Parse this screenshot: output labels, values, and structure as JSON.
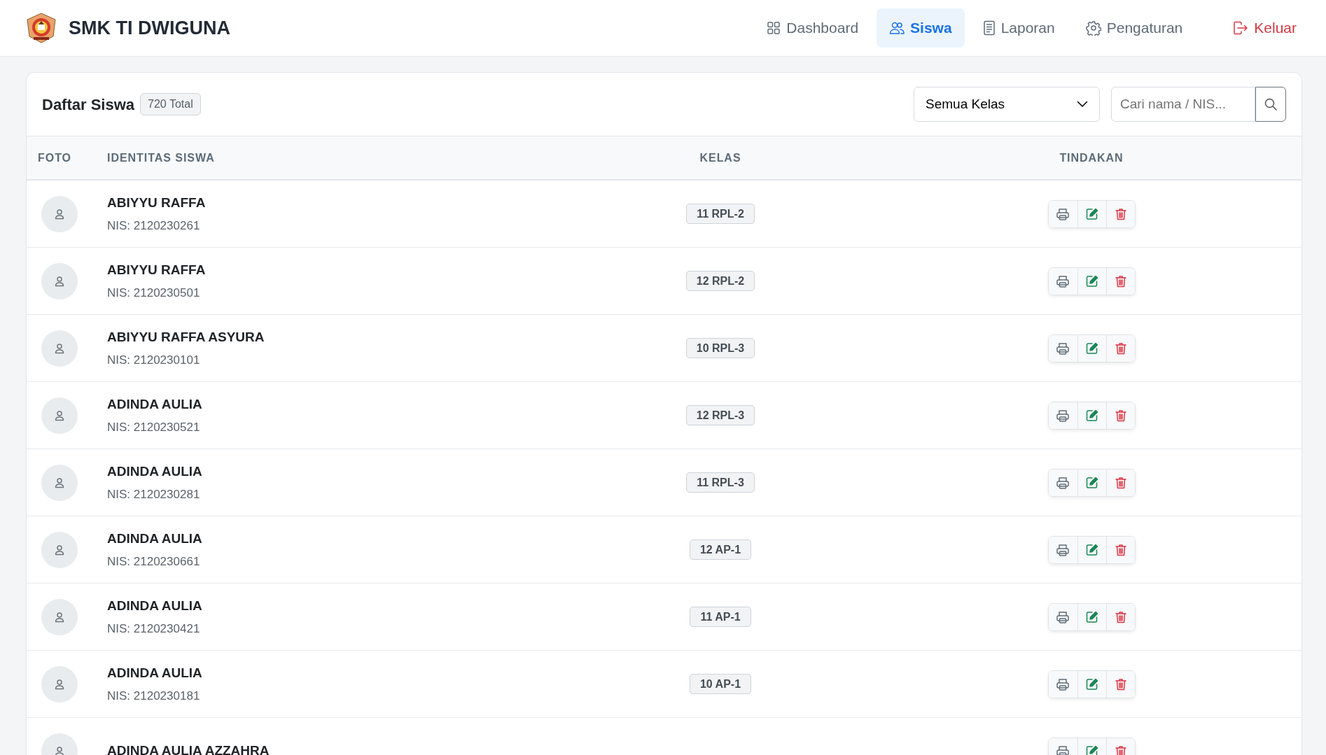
{
  "brand": {
    "name": "SMK TI DWIGUNA"
  },
  "nav": [
    {
      "kind": "grid",
      "label": "Dashboard",
      "selected": false
    },
    {
      "kind": "people",
      "label": "Siswa",
      "selected": true
    },
    {
      "kind": "doc",
      "label": "Laporan",
      "selected": false
    },
    {
      "kind": "gear",
      "label": "Pengaturan",
      "selected": false
    }
  ],
  "logout": {
    "label": "Keluar"
  },
  "card": {
    "title": "Daftar Siswa",
    "count": "720 Total",
    "filter": "Semua Kelas",
    "search_placeholder": "Cari nama / NIS..."
  },
  "table": {
    "columns": [
      "FOTO",
      "IDENTITAS SISWA",
      "KELAS",
      "TINDAKAN"
    ],
    "rows": [
      {
        "name": "ABIYYU RAFFA",
        "nis": "NIS: 2120230261",
        "kelas": "11 RPL-2"
      },
      {
        "name": "ABIYYU RAFFA",
        "nis": "NIS: 2120230501",
        "kelas": "12 RPL-2"
      },
      {
        "name": "ABIYYU RAFFA ASYURA",
        "nis": "NIS: 2120230101",
        "kelas": "10 RPL-3"
      },
      {
        "name": "ADINDA AULIA",
        "nis": "NIS: 2120230521",
        "kelas": "12 RPL-3"
      },
      {
        "name": "ADINDA AULIA",
        "nis": "NIS: 2120230281",
        "kelas": "11 RPL-3"
      },
      {
        "name": "ADINDA AULIA",
        "nis": "NIS: 2120230661",
        "kelas": "12 AP-1"
      },
      {
        "name": "ADINDA AULIA",
        "nis": "NIS: 2120230421",
        "kelas": "11 AP-1"
      },
      {
        "name": "ADINDA AULIA",
        "nis": "NIS: 2120230181",
        "kelas": "10 AP-1"
      },
      {
        "name": "ADINDA AULIA AZZAHRA"
      }
    ]
  }
}
